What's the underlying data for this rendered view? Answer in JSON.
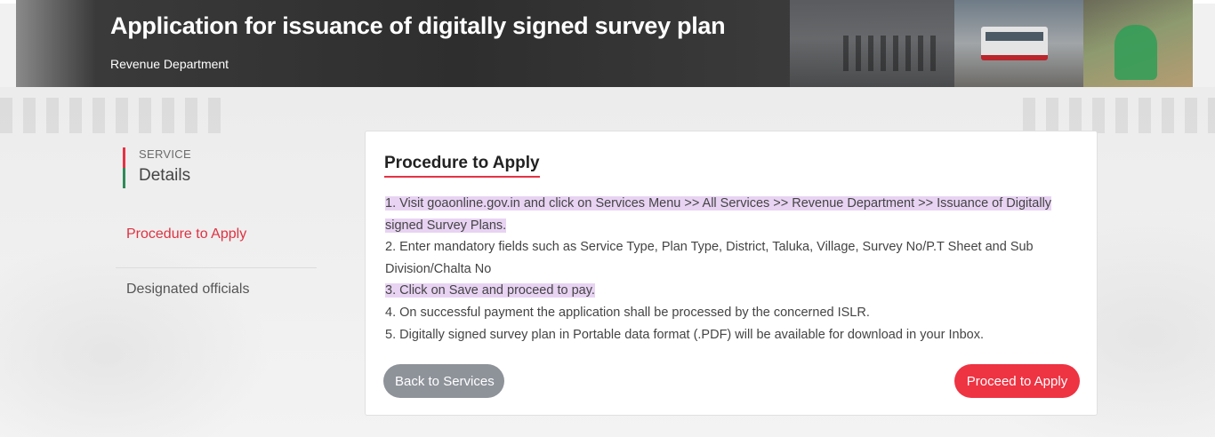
{
  "header": {
    "title": "Application for issuance of digitally signed survey plan",
    "department": "Revenue Department"
  },
  "sidebar": {
    "heading_small": "SERVICE",
    "heading_big": "Details",
    "items": [
      {
        "label": "Procedure to Apply",
        "active": true
      },
      {
        "label": "Designated officials",
        "active": false
      }
    ]
  },
  "main": {
    "section_title": "Procedure to Apply",
    "steps": [
      {
        "text": "1. Visit goaonline.gov.in and click on Services Menu >> All Services >> Revenue Department >> Issuance of Digitally signed Survey Plans.",
        "highlighted": true
      },
      {
        "text": "2. Enter mandatory fields such as Service Type, Plan Type, District, Taluka, Village, Survey No/P.T Sheet and Sub Division/Chalta No",
        "highlighted": false
      },
      {
        "text": "3. Click on Save and proceed to pay.",
        "highlighted": true
      },
      {
        "text": "4. On successful payment the application shall be processed by the concerned ISLR.",
        "highlighted": false
      },
      {
        "text": "5. Digitally signed survey plan in Portable data format (.PDF) will be available for download in your Inbox.",
        "highlighted": false
      }
    ],
    "back_button": "Back to Services",
    "proceed_button": "Proceed to Apply"
  },
  "colors": {
    "accent_red": "#ee3342",
    "accent_green": "#2e8b57",
    "highlight": "#e8d3f3",
    "button_grey": "#8e939a"
  }
}
